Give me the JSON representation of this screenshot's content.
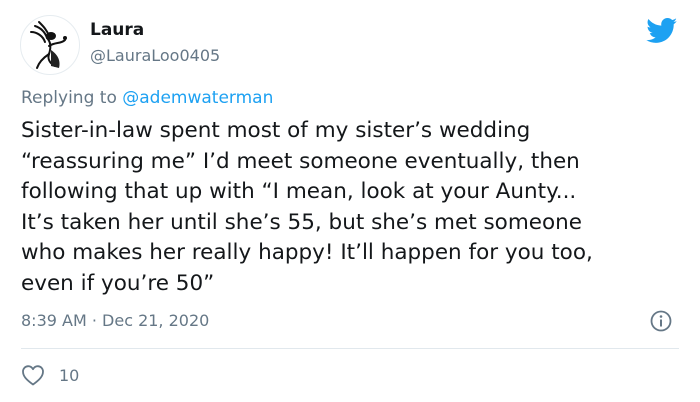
{
  "author": {
    "display_name": "Laura",
    "handle": "@LauraLoo0405",
    "avatar_icon": "ink-figure-avatar-icon"
  },
  "reply": {
    "prefix": "Replying to",
    "mention": "@ademwaterman"
  },
  "tweet": {
    "text": "Sister-in-law spent most of my sister’s wedding\n“reassuring me” I’d meet someone eventually, then\nfollowing that up with “I mean, look at your Aunty...\nIt’s taken her until she’s 55, but she’s met someone\nwho makes her really happy! It’ll happen for you too,\neven if you’re 50”",
    "timestamp": "8:39 AM · Dec 21, 2020",
    "likes": "10"
  },
  "icons": {
    "brand": "twitter-bird-icon",
    "info": "info-icon",
    "like": "heart-icon"
  },
  "colors": {
    "brand": "#1da1f2",
    "secondary_text": "#657786",
    "divider": "#e1e8ed"
  }
}
